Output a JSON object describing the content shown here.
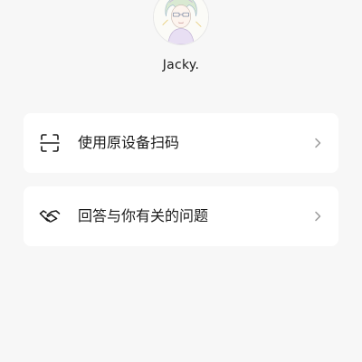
{
  "profile": {
    "username": "Jacky."
  },
  "menu": {
    "items": [
      {
        "label": "使用原设备扫码",
        "icon": "scan-icon"
      },
      {
        "label": "回答与你有关的问题",
        "icon": "handshake-icon"
      }
    ]
  },
  "colors": {
    "background": "#f7f7f7",
    "card": "#ffffff",
    "text": "#1a1a1a",
    "chevron": "#9a9a9a"
  }
}
